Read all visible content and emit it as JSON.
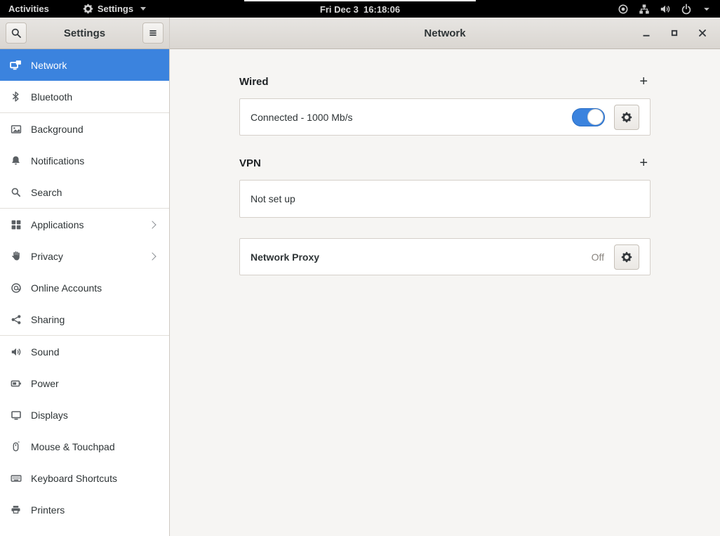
{
  "topbar": {
    "activities_label": "Activities",
    "app_menu_label": "Settings",
    "clock": "Fri Dec 3  16:18:06"
  },
  "sidebar": {
    "title": "Settings",
    "items": [
      {
        "id": "network",
        "label": "Network",
        "icon": "network-icon",
        "selected": true
      },
      {
        "id": "bluetooth",
        "label": "Bluetooth",
        "icon": "bluetooth-icon"
      },
      {
        "id": "background",
        "label": "Background",
        "icon": "background-icon",
        "group_start": true
      },
      {
        "id": "notifications",
        "label": "Notifications",
        "icon": "notifications-icon"
      },
      {
        "id": "search",
        "label": "Search",
        "icon": "search-icon"
      },
      {
        "id": "applications",
        "label": "Applications",
        "icon": "applications-icon",
        "chevron": true,
        "group_start": true
      },
      {
        "id": "privacy",
        "label": "Privacy",
        "icon": "privacy-icon",
        "chevron": true
      },
      {
        "id": "online-accounts",
        "label": "Online Accounts",
        "icon": "online-accounts-icon"
      },
      {
        "id": "sharing",
        "label": "Sharing",
        "icon": "sharing-icon"
      },
      {
        "id": "sound",
        "label": "Sound",
        "icon": "sound-icon",
        "group_start": true
      },
      {
        "id": "power",
        "label": "Power",
        "icon": "power-icon"
      },
      {
        "id": "displays",
        "label": "Displays",
        "icon": "displays-icon"
      },
      {
        "id": "mouse",
        "label": "Mouse & Touchpad",
        "icon": "mouse-icon"
      },
      {
        "id": "keyboard",
        "label": "Keyboard Shortcuts",
        "icon": "keyboard-icon"
      },
      {
        "id": "printers",
        "label": "Printers",
        "icon": "printers-icon"
      }
    ]
  },
  "window": {
    "title": "Network"
  },
  "content": {
    "wired": {
      "title": "Wired",
      "add_label": "+",
      "row_text": "Connected - 1000 Mb/s",
      "toggle_on": true
    },
    "vpn": {
      "title": "VPN",
      "add_label": "+",
      "row_text": "Not set up"
    },
    "proxy": {
      "title": "Network Proxy",
      "status": "Off"
    }
  },
  "colors": {
    "accent": "#3b83de",
    "topbar_bg": "#000000",
    "headerbar_bg": "#dedbd6",
    "content_bg": "#f6f5f3"
  }
}
